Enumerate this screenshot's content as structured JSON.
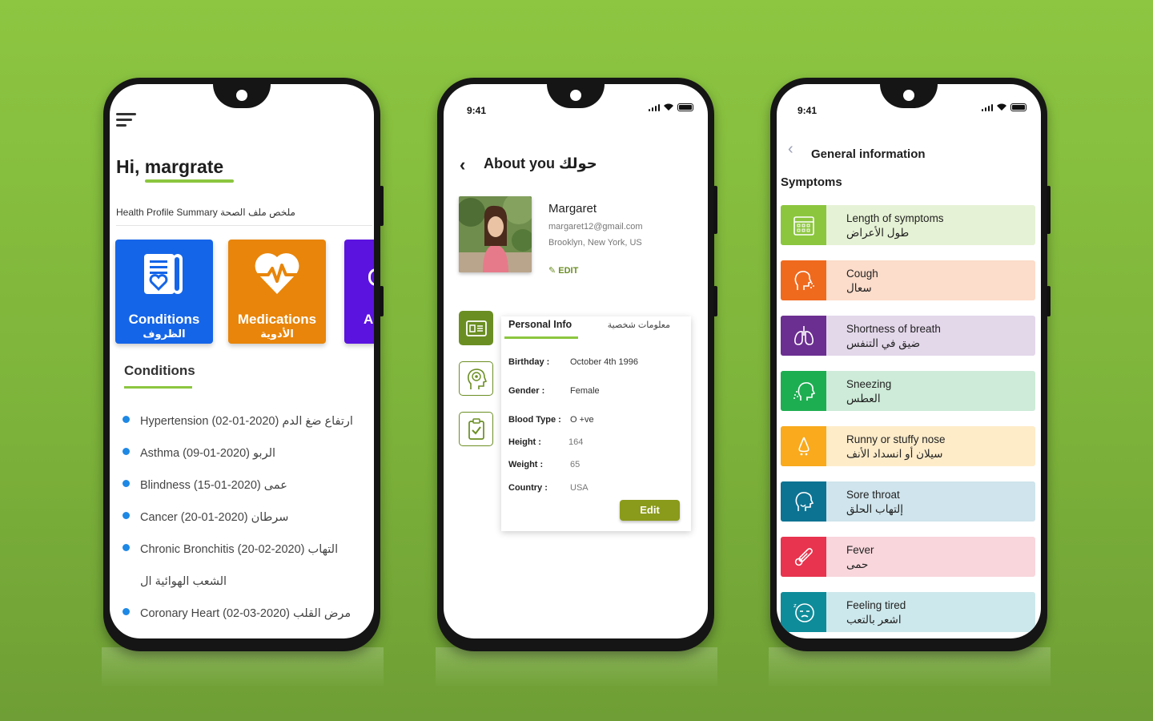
{
  "phone1": {
    "greeting": "Hi, margrate",
    "summary_label": "Health Profile Summary",
    "summary_ar": "ملخص ملف الصحة",
    "tiles": [
      {
        "en": "Conditions",
        "ar": "الظروف",
        "color": "#1565e8"
      },
      {
        "en": "Medications",
        "ar": "الأدوية",
        "color": "#e8850a"
      },
      {
        "en": "A",
        "ar": "",
        "color": "#5b13e0"
      }
    ],
    "conditions_heading": "Conditions",
    "conditions": [
      "Hypertension (02-01-2020)  ارتفاع ضغ الدم",
      "Asthma  (09-01-2020)  الربو",
      "Blindness  (15-01-2020)  عمى",
      "Cancer  (20-01-2020)  سرطان",
      "Chronic Bronchitis  (20-02-2020)  التهاب",
      "الشعب الهوائية ال",
      "Coronary Heart (02-03-2020)  مرض القلب"
    ]
  },
  "phone2": {
    "time": "9:41",
    "title": "About you حولك",
    "name": "Margaret",
    "email": "margaret12@gmail.com",
    "location": "Brooklyn, New York, US",
    "edit_link": "EDIT",
    "tab_en": "Personal Info",
    "tab_ar": "معلومات شخصية",
    "fields": [
      {
        "label": "Birthday :",
        "value": "October 4th 1996"
      },
      {
        "label": "Gender :",
        "value": "Female"
      },
      {
        "label": "Blood Type :",
        "value": "O +ve"
      },
      {
        "label": "Height :",
        "value": "164"
      },
      {
        "label": "Weight :",
        "value": "65"
      },
      {
        "label": "Country :",
        "value": "USA"
      }
    ],
    "edit_button": "Edit"
  },
  "phone3": {
    "time": "9:41",
    "title": "General information",
    "section": "Symptoms",
    "symptoms": [
      {
        "en": "Length of symptoms",
        "ar": "طول الأعراض",
        "icon": "calendar-icon",
        "color": "#8cc63f",
        "bg": "#e6f2d5"
      },
      {
        "en": "Cough",
        "ar": "سعال",
        "icon": "cough-icon",
        "color": "#f06a1e",
        "bg": "#fcdcca"
      },
      {
        "en": "Shortness of breath",
        "ar": "ضيق في التنفس",
        "icon": "lungs-icon",
        "color": "#6b2f91",
        "bg": "#e3d7ea"
      },
      {
        "en": "Sneezing",
        "ar": "العطس",
        "icon": "sneeze-icon",
        "color": "#1eae52",
        "bg": "#cdebd8"
      },
      {
        "en": "Runny or stuffy nose",
        "ar": "سيلان أو انسداد الأنف",
        "icon": "nose-icon",
        "color": "#f9aa1d",
        "bg": "#feecc9"
      },
      {
        "en": "Sore throat",
        "ar": "إلتهاب الحلق",
        "icon": "throat-icon",
        "color": "#0d7393",
        "bg": "#cfe4ec"
      },
      {
        "en": "Fever",
        "ar": "حمى",
        "icon": "thermometer-icon",
        "color": "#e8344e",
        "bg": "#f8d6dc"
      },
      {
        "en": "Feeling tired",
        "ar": "اشعر بالتعب",
        "icon": "tired-face-icon",
        "color": "#0f8c9a",
        "bg": "#cde8ec"
      }
    ]
  }
}
